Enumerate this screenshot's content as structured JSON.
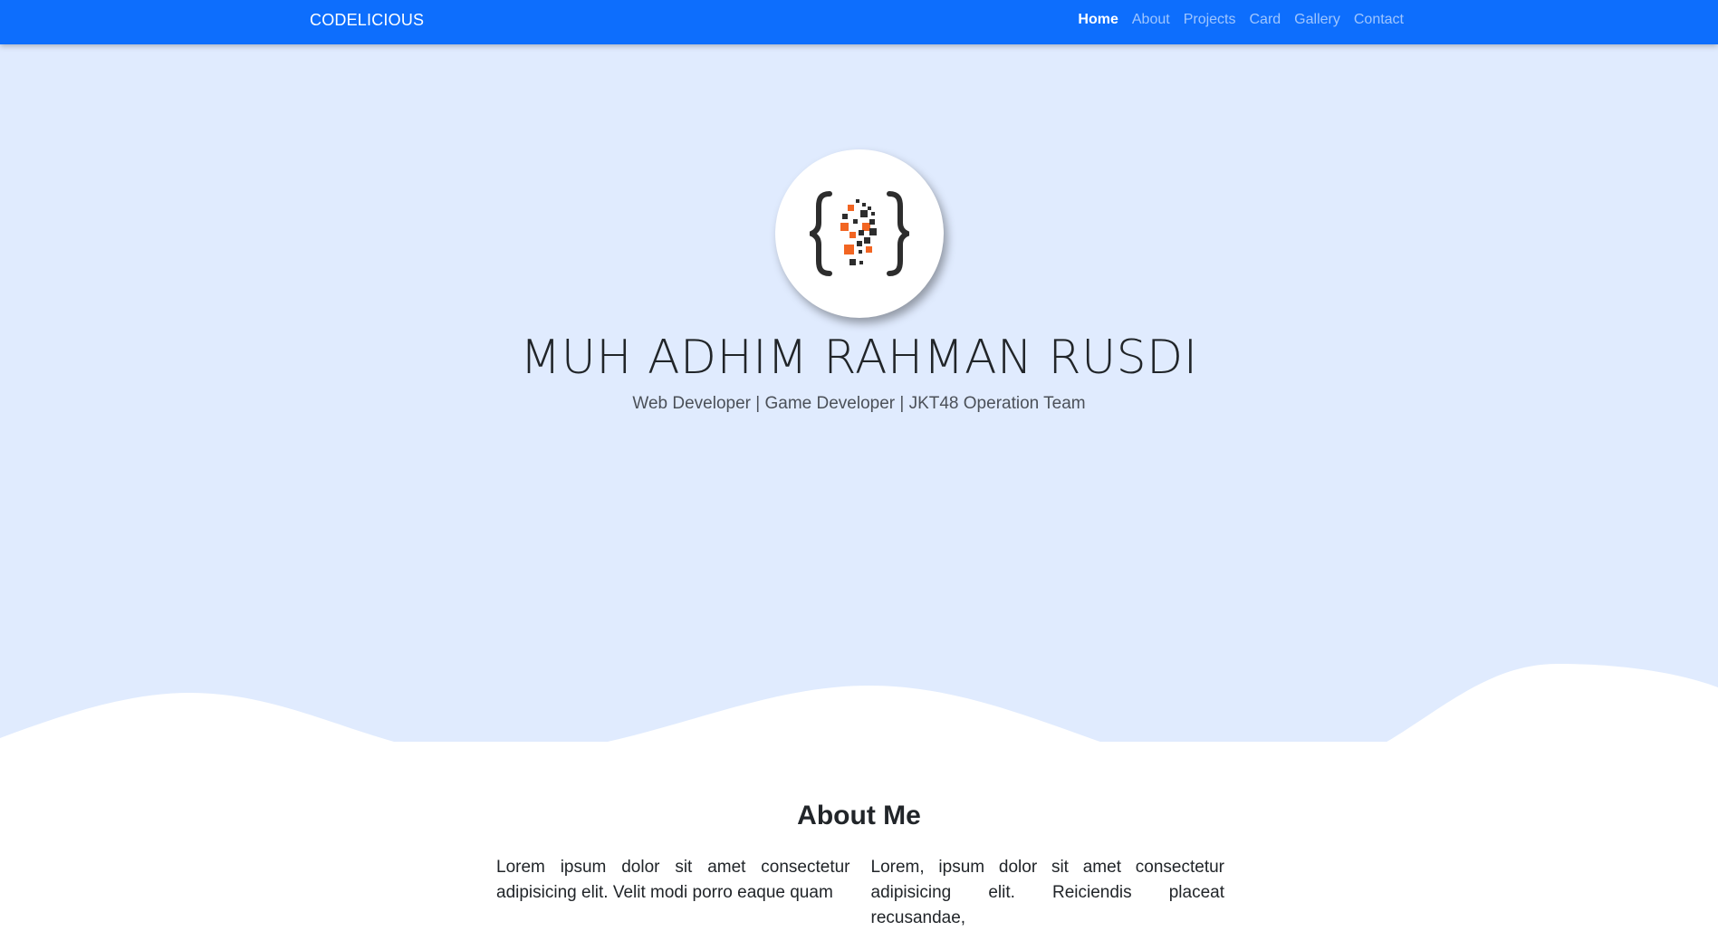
{
  "navbar": {
    "brand": "CODELICIOUS",
    "links": [
      {
        "label": "Home",
        "active": true
      },
      {
        "label": "About",
        "active": false
      },
      {
        "label": "Projects",
        "active": false
      },
      {
        "label": "Card",
        "active": false
      },
      {
        "label": "Gallery",
        "active": false
      },
      {
        "label": "Contact",
        "active": false
      }
    ]
  },
  "hero": {
    "logo_icon": "code-braces-logo",
    "name": "MUH ADHIM RAHMAN RUSDI",
    "tagline": "Web Developer | Game Developer | JKT48 Operation Team"
  },
  "about": {
    "title": "About Me",
    "paragraphs": [
      "Lorem ipsum dolor sit amet consectetur adipisicing elit. Velit modi porro eaque quam",
      "Lorem, ipsum dolor sit amet consectetur adipisicing elit. Reiciendis placeat recusandae,"
    ]
  },
  "colors": {
    "navbar": "#0d6efd",
    "hero_bg": "#e0ebfe",
    "logo_orange": "#f26522",
    "logo_dark": "#2d2d2d"
  }
}
